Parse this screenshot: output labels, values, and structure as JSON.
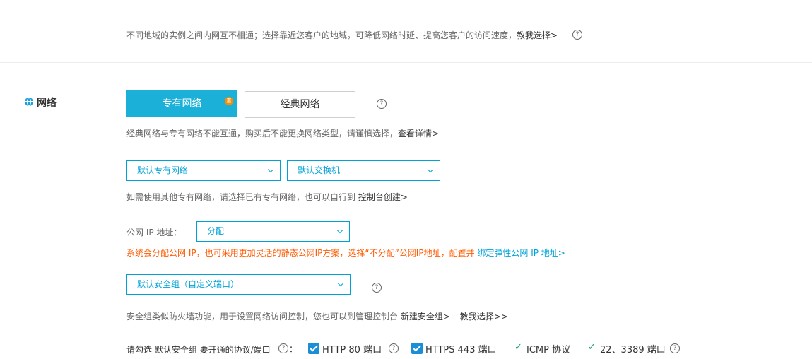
{
  "region": {
    "tip_text": "不同地域的实例之间内网互不相通；选择靠近您客户的地域，可降低网络时延、提高您客户的访问速度，",
    "tip_link": "教我选择>"
  },
  "network": {
    "section_title": "网络",
    "tabs": [
      {
        "label": "专有网络",
        "badge": "惠"
      },
      {
        "label": "经典网络"
      }
    ],
    "tab_tip_text": "经典网络与专有网络不能互通，购买后不能更换网络类型，请谨慎选择，",
    "tab_tip_link": "查看详情>",
    "vpc_select": "默认专有网络",
    "vswitch_select": "默认交换机",
    "vpc_tip_text": "如需使用其他专有网络，请选择已有专有网络，也可以自行到",
    "vpc_tip_link": "控制台创建>",
    "public_ip_label": "公网 IP 地址：",
    "public_ip_select": "分配",
    "public_ip_warning": "系统会分配公网 IP，也可采用更加灵活的静态公网IP方案，选择“不分配”公网IP地址，配置并",
    "public_ip_link": "绑定弹性公网 IP 地址>",
    "sg_select": "默认安全组（自定义端口）",
    "sg_tip_text": "安全组类似防火墙功能，用于设置网络访问控制，您也可以到管理控制台",
    "sg_tip_link1": "新建安全组>",
    "sg_tip_link2": "教我选择>>",
    "protocol_label": "请勾选 默认安全组 要开通的协议/端口",
    "protocol_colon": "：",
    "protocols": [
      {
        "label": "HTTP 80 端口",
        "checked": true
      },
      {
        "label": "HTTPS 443 端口",
        "checked": true
      },
      {
        "label": "ICMP 协议",
        "fixed": true
      },
      {
        "label": "22、3389 端口",
        "fixed": true
      }
    ]
  },
  "colors": {
    "accent": "#00a2d6",
    "tab_active": "#1ab0d8",
    "warning": "#ff5a00",
    "badge": "#ff8a00",
    "checkbox": "#1a8fd6",
    "check": "#19a15f"
  },
  "icons": {
    "help": "?",
    "check": "✓"
  }
}
